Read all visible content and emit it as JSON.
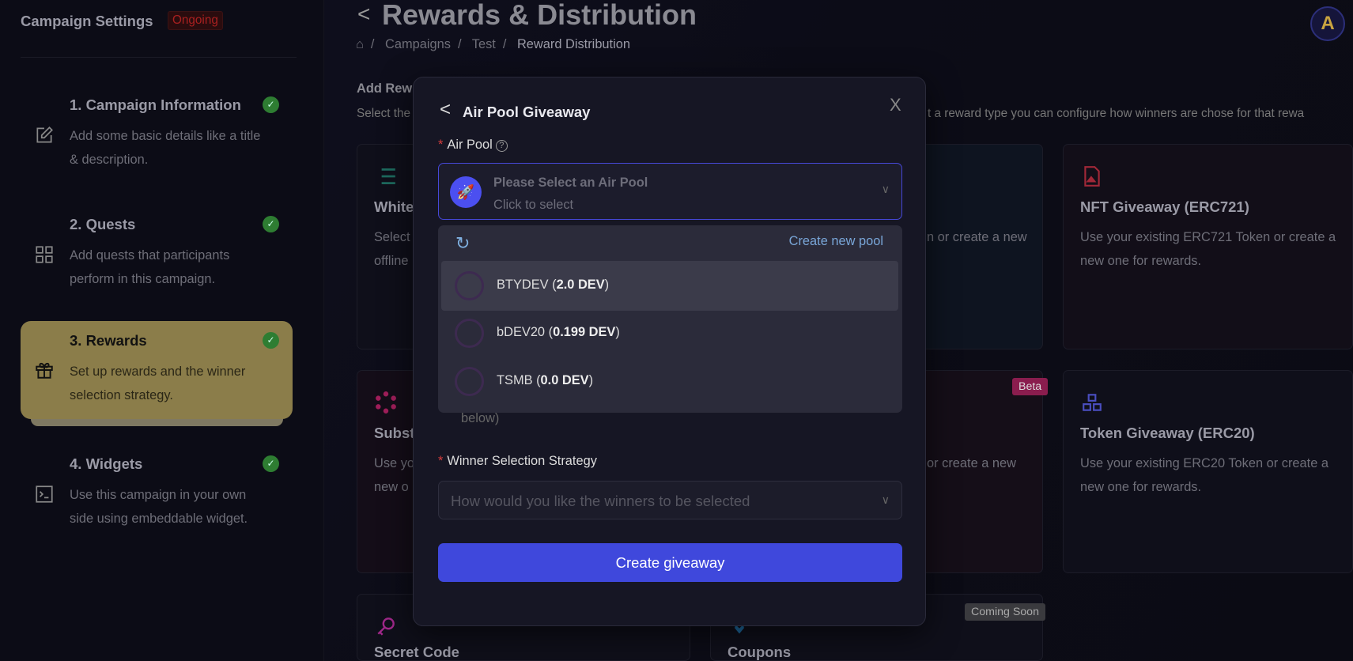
{
  "sidebar": {
    "title": "Campaign Settings",
    "status": "Ongoing",
    "steps": [
      {
        "title": "1. Campaign Information",
        "desc": "Add some basic details like a title & description.",
        "icon": "edit-icon",
        "done": true
      },
      {
        "title": "2. Quests",
        "desc": "Add quests that participants perform in this campaign.",
        "icon": "grid-icon",
        "done": true
      },
      {
        "title": "3. Rewards",
        "desc": "Set up rewards and the winner selection strategy.",
        "icon": "gift-icon",
        "done": true,
        "active": true
      },
      {
        "title": "4. Widgets",
        "desc": "Use this campaign in your own side using embeddable widget.",
        "icon": "terminal-icon",
        "done": true
      }
    ]
  },
  "header": {
    "back": "<",
    "title": "Rewards & Distribution",
    "breadcrumb": [
      "Campaigns",
      "Test",
      "Reward Distribution"
    ],
    "avatar": "A"
  },
  "main": {
    "section_title": "Add Rew",
    "section_desc_left": "Select the",
    "section_desc_right": "t a reward type you can configure how winners are chose for that rewa",
    "cards": [
      {
        "title": "White",
        "desc": "Select offline"
      },
      {
        "title": "",
        "desc": "n or create a new"
      },
      {
        "title": "NFT Giveaway (ERC721)",
        "desc": "Use your existing ERC721 Token or create a new one for rewards."
      },
      {
        "title": "Subst",
        "desc": "Use yo new o"
      },
      {
        "title": "",
        "desc": "or create a new",
        "badge": "Beta"
      },
      {
        "title": "Token Giveaway (ERC20)",
        "desc": "Use your existing ERC20 Token or create a new one for rewards."
      },
      {
        "title": "Secret Code",
        "desc": ""
      },
      {
        "title": "Coupons",
        "desc": "",
        "badge": "Coming Soon"
      }
    ]
  },
  "modal": {
    "back": "<",
    "title": "Air Pool Giveaway",
    "close": "X",
    "air_pool_label": "Air Pool",
    "help": "?",
    "select_placeholder": "Please Select an Air Pool",
    "select_hint": "Click to select",
    "create_pool": "Create new pool",
    "pools": [
      {
        "name": "BTYDEV",
        "amount": "2.0 DEV"
      },
      {
        "name": "bDEV20",
        "amount": "0.199 DEV"
      },
      {
        "name": "TSMB",
        "amount": "0.0 DEV"
      }
    ],
    "below_text": "below)",
    "winner_label": "Winner Selection Strategy",
    "winner_placeholder": "How would you like the winners to be selected",
    "submit": "Create giveaway"
  },
  "colors": {
    "accent": "#3f48dc",
    "active_step": "#8b7d4a",
    "success": "#2e7d32",
    "ongoing": "#a82020"
  }
}
